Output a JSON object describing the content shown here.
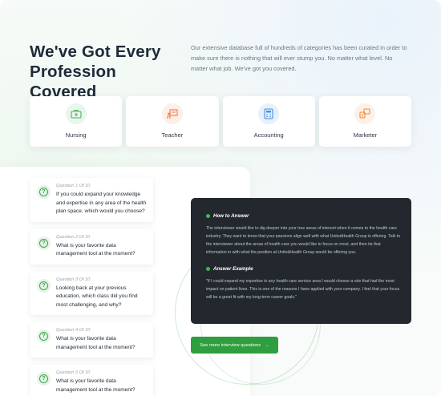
{
  "header": {
    "title": "We've Got Every Profession Covered",
    "intro": "Our extensive database full of hundreds of categories has been curated in order to make sure there is nothing that will ever stump you. No matter what level. No matter what job. We've got you covered."
  },
  "professions": [
    {
      "label": "Nursing",
      "icon": "briefcase-medical-icon",
      "color": "#e9f6ec",
      "accent": "#47b15a"
    },
    {
      "label": "Teacher",
      "icon": "teacher-board-icon",
      "color": "#fdeee7",
      "accent": "#ef7b4e"
    },
    {
      "label": "Accounting",
      "icon": "calculator-icon",
      "color": "#e7f0fb",
      "accent": "#4a8be0"
    },
    {
      "label": "Marketer",
      "icon": "marketing-icon",
      "color": "#fdf0e6",
      "accent": "#f08a3c"
    }
  ],
  "questions": [
    {
      "number": "Question 1 Of 10",
      "text": "If you could expand your knowledge and expertise in any area of the health plan space, which would you choose?"
    },
    {
      "number": "Question 2 Of 10",
      "text": "What is your favorite data management tool at the moment?"
    },
    {
      "number": "Question 3 Of 10",
      "text": "Looking back at your previous education, which class did you find most challenging, and why?"
    },
    {
      "number": "Question 4 Of 10",
      "text": "What is your favorite data management tool at the moment?"
    },
    {
      "number": "Question 5 Of 10",
      "text": "What is your favorite data management tool at the moment?"
    }
  ],
  "answer": {
    "how_title": "How to Answer",
    "how_text": "The interviewer would like to dig deeper into your true areas of interest when it comes to the health care industry. They want to know that your passions align well with what UnitedHealth Group is offering. Talk to the interviewer about the areas of health care you would like to focus on most, and then tie that information in with what the position at UnitedHealth Group would be offering you.",
    "example_title": "Answer Example",
    "example_text": "\"If I could expand my expertise in any health care service area I would choose a role that had the most impact on patient lives. This is one of the reasons I have applied with your company. I feel that your focus will be a great fit with my long-term career goals.\""
  },
  "cta": {
    "label": "See more interview questions",
    "arrow": "→"
  }
}
